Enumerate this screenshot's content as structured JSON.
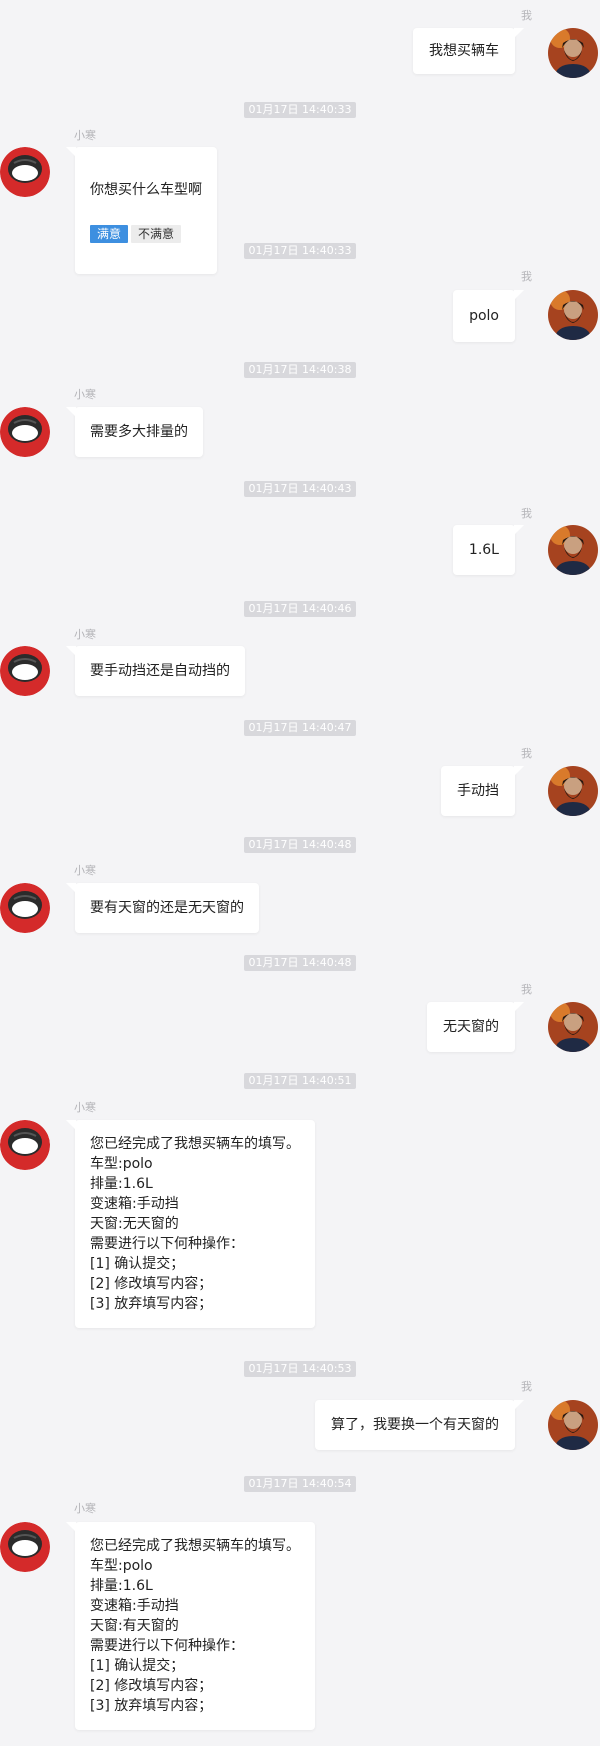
{
  "labels": {
    "user": "我",
    "bot": "小寒"
  },
  "times": [
    "01月17日 14:40:33",
    "01月17日 14:40:33",
    "01月17日 14:40:38",
    "01月17日 14:40:43",
    "01月17日 14:40:46",
    "01月17日 14:40:47",
    "01月17日 14:40:48",
    "01月17日 14:40:48",
    "01月17日 14:40:51",
    "01月17日 14:40:53",
    "01月17日 14:40:54"
  ],
  "messages": [
    {
      "sender": "user",
      "text": "我想买辆车"
    },
    {
      "sender": "bot",
      "text": "你想买什么车型啊",
      "feedback": {
        "satisfied": "满意",
        "unsatisfied": "不满意"
      }
    },
    {
      "sender": "user",
      "text": "polo"
    },
    {
      "sender": "bot",
      "text": "需要多大排量的"
    },
    {
      "sender": "user",
      "text": "1.6L"
    },
    {
      "sender": "bot",
      "text": "要手动挡还是自动挡的"
    },
    {
      "sender": "user",
      "text": "手动挡"
    },
    {
      "sender": "bot",
      "text": "要有天窗的还是无天窗的"
    },
    {
      "sender": "user",
      "text": "无天窗的"
    },
    {
      "sender": "bot",
      "text": "您已经完成了我想买辆车的填写。\n车型:polo\n排量:1.6L\n变速箱:手动挡\n天窗:无天窗的\n需要进行以下何种操作：\n[1] 确认提交；\n[2] 修改填写内容；\n[3] 放弃填写内容；"
    },
    {
      "sender": "user",
      "text": "算了，我要换一个有天窗的"
    },
    {
      "sender": "bot",
      "text": "您已经完成了我想买辆车的填写。\n车型:polo\n排量:1.6L\n变速箱:手动挡\n天窗:有天窗的\n需要进行以下何种操作：\n[1] 确认提交；\n[2] 修改填写内容；\n[3] 放弃填写内容；"
    }
  ],
  "colors": {
    "background": "#f4f4f6",
    "bubble": "#ffffff",
    "timestamp_bg": "#d8d8dc",
    "satisfied_button": "#3d8fe0"
  },
  "icons": {
    "user_avatar": "bearded-man-avatar",
    "bot_avatar": "red-robot-avatar"
  }
}
